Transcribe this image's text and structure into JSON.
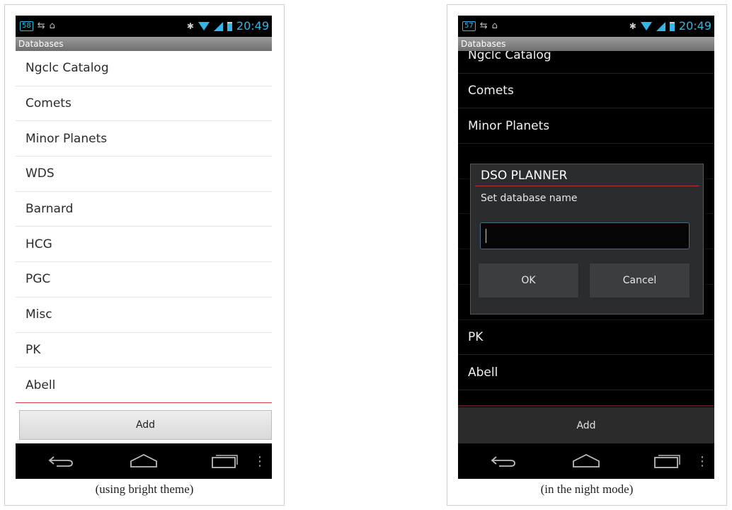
{
  "status_bar": {
    "left_panel_badge": "58",
    "right_panel_badge": "57",
    "time": "20:49"
  },
  "title_bar": {
    "title": "Databases"
  },
  "bright_list": [
    "Ngclc Catalog",
    "Comets",
    "Minor Planets",
    "WDS",
    "Barnard",
    "HCG",
    "PGC",
    "Misc",
    "PK",
    "Abell"
  ],
  "night_list": [
    "Ngclc Catalog",
    "Comets",
    "Minor Planets",
    "",
    "",
    "",
    "",
    "",
    "PK",
    "Abell",
    ""
  ],
  "add_label": "Add",
  "dialog": {
    "title": "DSO PLANNER",
    "message": "Set database name",
    "input_value": "",
    "ok_label": "OK",
    "cancel_label": "Cancel"
  },
  "captions": {
    "bright": "(using bright theme)",
    "night": "(in the night mode)"
  },
  "icons": {
    "status": [
      "notification-badge-icon",
      "notification-icon",
      "home-icon",
      "bluetooth-icon",
      "wifi-icon",
      "signal-icon",
      "battery-icon"
    ],
    "nav": [
      "back-icon",
      "home-icon",
      "recent-apps-icon",
      "menu-icon"
    ]
  },
  "colors": {
    "accent": "#33b5e5",
    "divider_red": "#cc4444"
  }
}
